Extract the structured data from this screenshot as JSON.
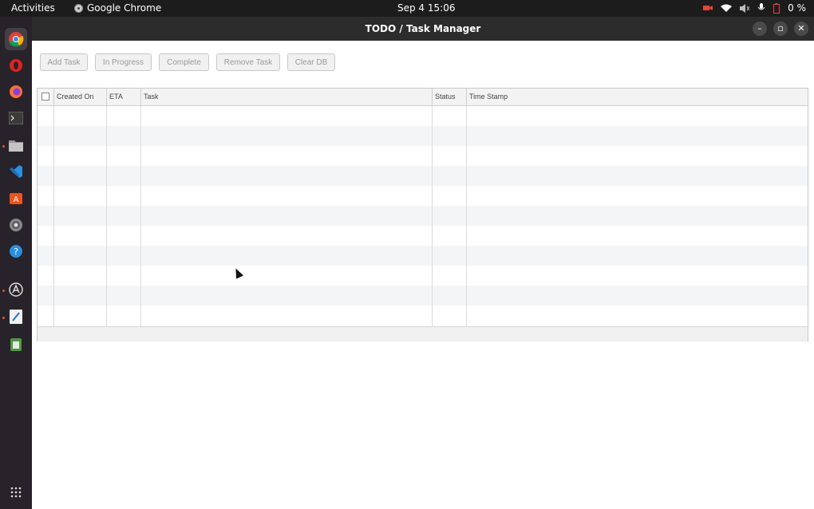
{
  "topbar": {
    "activities": "Activities",
    "app_name": "Google Chrome",
    "clock": "Sep 4  15:06",
    "battery": "0 %"
  },
  "dock": {
    "items": [
      "chrome",
      "opera",
      "firefox",
      "terminal",
      "files",
      "vscode",
      "software-center",
      "settings",
      "help",
      "app-store",
      "text-editor",
      "trash"
    ]
  },
  "window": {
    "title": "TODO / Task Manager"
  },
  "toolbar": {
    "add_task": "Add Task",
    "in_progress": "In Progress",
    "complete": "Complete",
    "remove_task": "Remove Task",
    "clear_db": "Clear DB"
  },
  "table": {
    "columns": [
      "Created On",
      "ETA",
      "Task",
      "Status",
      "Time Stamp"
    ]
  },
  "colors": {
    "accent": "#e95420",
    "topbar": "#1c1c1c",
    "dock": "#28232a"
  }
}
